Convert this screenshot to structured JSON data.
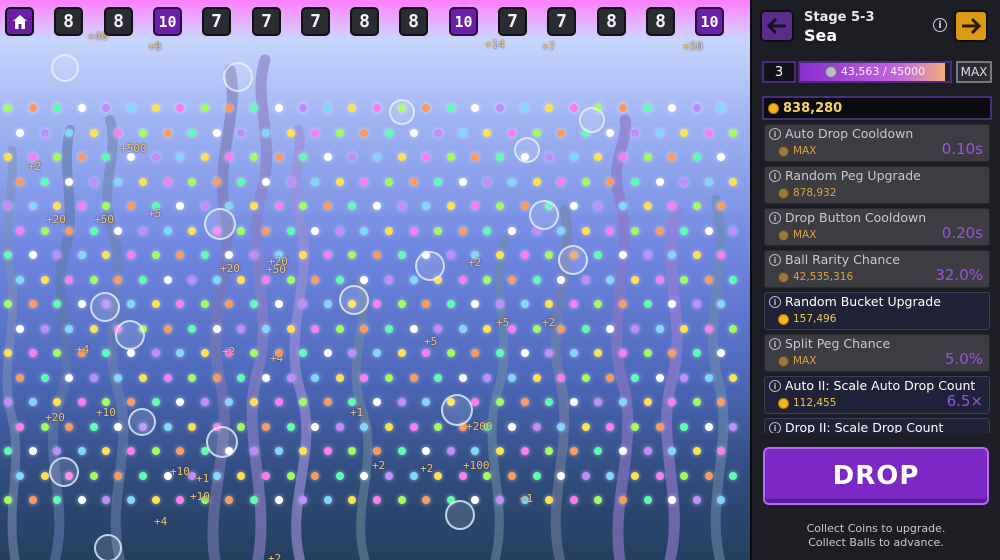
{
  "buckets": [
    {
      "kind": "home",
      "icon": "home-icon"
    },
    {
      "label": "8",
      "tier": "normal"
    },
    {
      "label": "8",
      "tier": "normal"
    },
    {
      "label": "10",
      "tier": "high"
    },
    {
      "label": "7",
      "tier": "normal"
    },
    {
      "label": "7",
      "tier": "normal"
    },
    {
      "label": "7",
      "tier": "normal"
    },
    {
      "label": "8",
      "tier": "normal"
    },
    {
      "label": "8",
      "tier": "normal"
    },
    {
      "label": "10",
      "tier": "high"
    },
    {
      "label": "7",
      "tier": "normal"
    },
    {
      "label": "7",
      "tier": "normal"
    },
    {
      "label": "8",
      "tier": "normal"
    },
    {
      "label": "8",
      "tier": "normal"
    },
    {
      "label": "10",
      "tier": "high"
    }
  ],
  "floating_texts": [
    "+40",
    "+8",
    "+14",
    "+7",
    "+50",
    "+500",
    "+20",
    "+50",
    "+5",
    "+20",
    "+50",
    "+20",
    "+2",
    "+5",
    "+2",
    "+5",
    "+2",
    "+4",
    "+2",
    "+4",
    "+20",
    "+10",
    "+1",
    "+200",
    "+100",
    "+2",
    "+1",
    "+10",
    "+2",
    "+10",
    "+2",
    "+1",
    "+4"
  ],
  "header": {
    "stage_label": "Stage 5-3",
    "stage_name": "Sea",
    "info_glyph": "i",
    "back_icon": "arrow-left-icon",
    "next_icon": "arrow-right-icon"
  },
  "progress": {
    "level": "3",
    "text": "43,563 / 45000",
    "current": 43563,
    "target": 45000,
    "max_label": "MAX"
  },
  "coins": {
    "value": "838,280"
  },
  "upgrades": [
    {
      "name": "Auto Drop Cooldown",
      "cost": "MAX",
      "value": "0.10s",
      "active": false
    },
    {
      "name": "Random Peg Upgrade",
      "cost": "878,932",
      "value": "",
      "active": false
    },
    {
      "name": "Drop Button Cooldown",
      "cost": "MAX",
      "value": "0.20s",
      "active": false
    },
    {
      "name": "Ball Rarity Chance",
      "cost": "42,535,316",
      "value": "32.0%",
      "active": false
    },
    {
      "name": "Random Bucket Upgrade",
      "cost": "157,496",
      "value": "",
      "active": true
    },
    {
      "name": "Split Peg Chance",
      "cost": "MAX",
      "value": "5.0%",
      "active": false
    },
    {
      "name": "Auto II: Scale Auto Drop Count",
      "cost": "112,455",
      "value": "6.5×",
      "active": true
    },
    {
      "name": "Drop II: Scale Drop Count",
      "cost": "",
      "value": "",
      "active": true
    }
  ],
  "drop_button": {
    "label": "DROP"
  },
  "hint": {
    "line1": "Collect Coins to upgrade.",
    "line2": "Collect Balls to advance."
  },
  "colors": {
    "accent_purple": "#7b28c4",
    "coin_gold": "#f2b51c",
    "next_orange": "#d99b12"
  }
}
